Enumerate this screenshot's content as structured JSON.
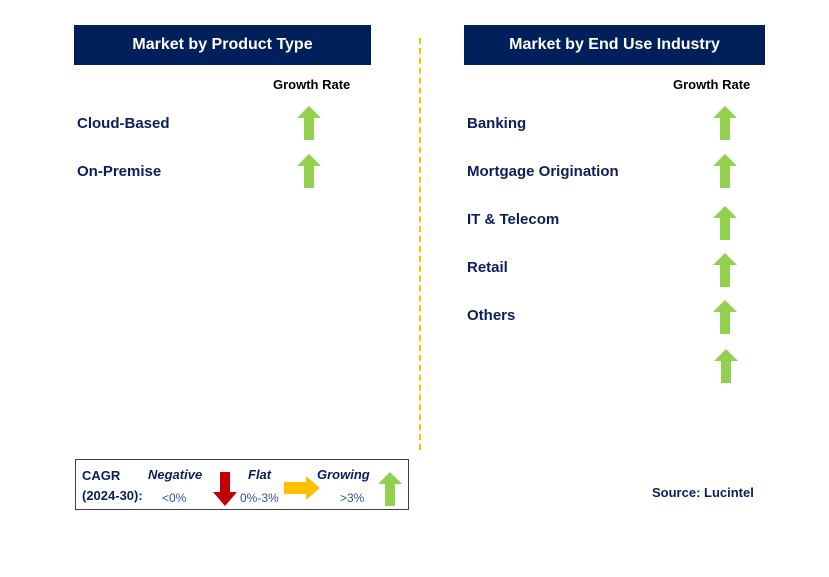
{
  "left_panel": {
    "title": "Market by Product Type",
    "growth_header": "Growth Rate",
    "rows": [
      {
        "label": "Cloud-Based",
        "trend": "growing",
        "icon": "arrow-up-icon"
      },
      {
        "label": "On-Premise",
        "trend": "growing",
        "icon": "arrow-up-icon"
      }
    ]
  },
  "right_panel": {
    "title": "Market by End Use Industry",
    "growth_header": "Growth Rate",
    "rows": [
      {
        "label": "Banking",
        "trend": "growing",
        "icon": "arrow-up-icon"
      },
      {
        "label": "Mortgage Origination",
        "trend": "growing",
        "icon": "arrow-up-icon"
      },
      {
        "label": "IT & Telecom",
        "trend": "growing",
        "icon": "arrow-up-icon"
      },
      {
        "label": "Retail",
        "trend": "growing",
        "icon": "arrow-up-icon"
      },
      {
        "label": "Others",
        "trend": "growing",
        "icon": "arrow-up-icon"
      },
      {
        "label": "",
        "trend": "growing",
        "icon": "arrow-up-icon"
      }
    ]
  },
  "legend": {
    "cagr_line1": "CAGR",
    "cagr_line2": "(2024-30):",
    "negative": {
      "label": "Negative",
      "range": "<0%",
      "icon": "arrow-down-icon"
    },
    "flat": {
      "label": "Flat",
      "range": "0%-3%",
      "icon": "arrow-right-icon"
    },
    "growing": {
      "label": "Growing",
      "range": ">3%",
      "icon": "arrow-up-icon"
    }
  },
  "source": "Source: Lucintel",
  "colors": {
    "header_bg": "#00205b",
    "label_text": "#0a1f5c",
    "growing": "#92d050",
    "flat": "#ffc000",
    "negative": "#c00000",
    "divider": "#ffc000"
  }
}
